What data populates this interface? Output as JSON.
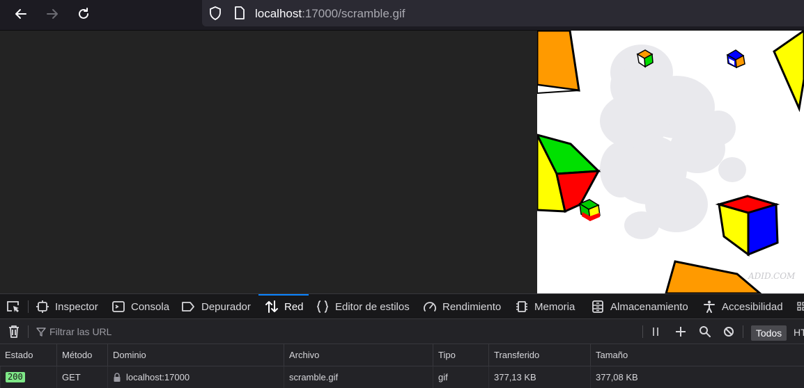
{
  "browser": {
    "url_host": "localhost",
    "url_rest": ":17000/scramble.gif"
  },
  "devtools": {
    "tabs": [
      {
        "label": "Inspector",
        "icon": "inspector-icon"
      },
      {
        "label": "Consola",
        "icon": "console-icon"
      },
      {
        "label": "Depurador",
        "icon": "debugger-icon"
      },
      {
        "label": "Red",
        "icon": "network-icon",
        "active": true
      },
      {
        "label": "Editor de estilos",
        "icon": "style-editor-icon"
      },
      {
        "label": "Rendimiento",
        "icon": "performance-icon"
      },
      {
        "label": "Memoria",
        "icon": "memory-icon"
      },
      {
        "label": "Almacenamiento",
        "icon": "storage-icon"
      },
      {
        "label": "Accesibilidad",
        "icon": "accessibility-icon"
      }
    ],
    "filter_placeholder": "Filtrar las URL",
    "filter_all": "Todos",
    "filter_more": "HT",
    "columns": [
      "Estado",
      "Método",
      "Dominio",
      "Archivo",
      "Tipo",
      "Transferido",
      "Tamaño"
    ],
    "rows": [
      {
        "status": "200",
        "method": "GET",
        "domain": "localhost:17000",
        "file": "scramble.gif",
        "type": "gif",
        "transferred": "377,13 KB",
        "size": "377,08 KB"
      }
    ]
  },
  "gif": {
    "watermark": "ADID.COM"
  },
  "colors": {
    "accent": "#0a84ff",
    "status_ok": "#7ee787"
  }
}
